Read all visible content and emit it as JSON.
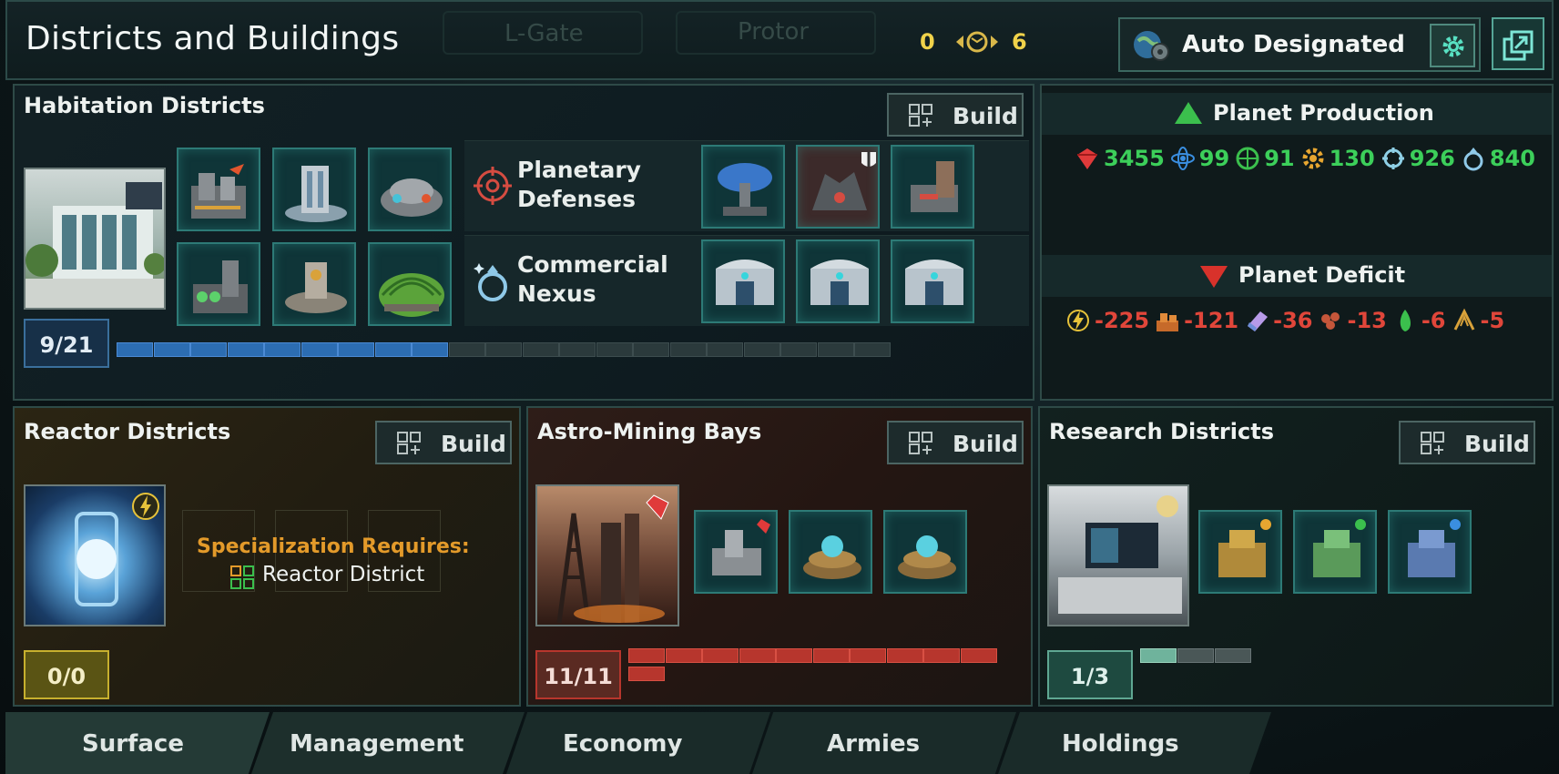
{
  "header": {
    "title": "Districts and Buildings",
    "ghost_left": "L-Gate",
    "ghost_right": "Protor",
    "count_a": "0",
    "count_b": "6",
    "designation_label": "Auto Designated"
  },
  "habitation": {
    "title": "Habitation Districts",
    "build_label": "Build",
    "counter": "9/21",
    "slots_filled": 9,
    "slots_total": 21,
    "buildings": [
      {
        "label": "Planetary Defenses",
        "line1": "Planetary",
        "line2": "Defenses"
      },
      {
        "label": "Commercial Nexus",
        "line1": "Commercial",
        "line2": "Nexus"
      }
    ]
  },
  "production": {
    "title": "Planet Production",
    "items": [
      {
        "icon": "minerals-icon",
        "value": "3455",
        "color": "#3ccf5a"
      },
      {
        "icon": "physics-icon",
        "value": "99",
        "color": "#3ccf5a"
      },
      {
        "icon": "society-icon",
        "value": "91",
        "color": "#3ccf5a"
      },
      {
        "icon": "engineering-icon",
        "value": "130",
        "color": "#3ccf5a"
      },
      {
        "icon": "trade-icon",
        "value": "926",
        "color": "#3ccf5a"
      },
      {
        "icon": "alloys-icon",
        "value": "840",
        "color": "#3ccf5a"
      }
    ]
  },
  "deficit": {
    "title": "Planet Deficit",
    "items": [
      {
        "icon": "energy-icon",
        "value": "-225",
        "color": "#e0463a"
      },
      {
        "icon": "consumer-goods-icon",
        "value": "-121",
        "color": "#e0463a"
      },
      {
        "icon": "crystals-icon",
        "value": "-36",
        "color": "#e0463a"
      },
      {
        "icon": "food-icon",
        "value": "-13",
        "color": "#e0463a"
      },
      {
        "icon": "gas-icon",
        "value": "-6",
        "color": "#e0463a"
      },
      {
        "icon": "motes-icon",
        "value": "-5",
        "color": "#e0463a"
      }
    ]
  },
  "reactor": {
    "title": "Reactor Districts",
    "build_label": "Build",
    "spec_label": "Specialization Requires:",
    "spec_value": "Reactor District",
    "counter": "0/0"
  },
  "astro": {
    "title": "Astro-Mining Bays",
    "build_label": "Build",
    "counter": "11/11",
    "slots_filled": 11,
    "slots_total": 11
  },
  "research": {
    "title": "Research Districts",
    "build_label": "Build",
    "counter": "1/3",
    "slots_filled": 1,
    "slots_total": 3
  },
  "tabs": [
    "Surface",
    "Management",
    "Economy",
    "Armies",
    "Holdings"
  ],
  "colors": {
    "accent_teal": "#55a697",
    "habitation_blue": "#2c6db2",
    "astro_red": "#b7362d",
    "research_green": "#6fb39c",
    "reactor_gold": "#c7b02e"
  }
}
